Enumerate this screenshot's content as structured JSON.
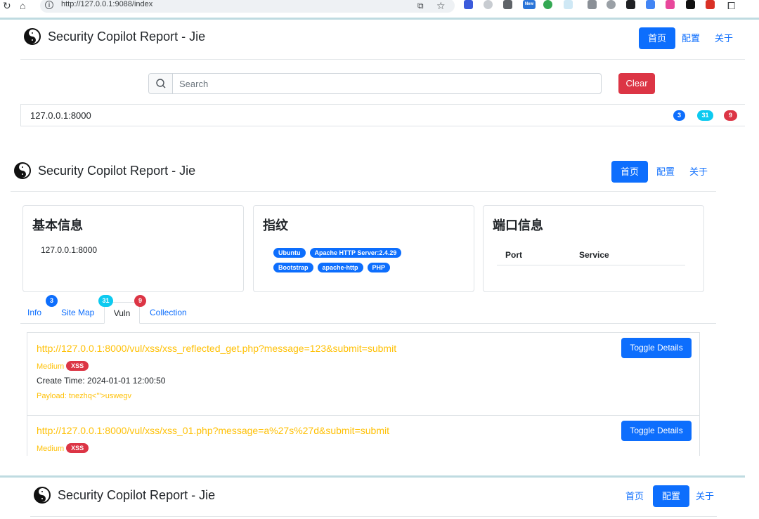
{
  "browser": {
    "url": "http://127.0.0.1:9088/index",
    "extension_new_badge": "New",
    "nav_icons": [
      "reload-icon",
      "home-icon"
    ]
  },
  "app": {
    "title": "Security Copilot Report - Jie",
    "nav": {
      "home": "首页",
      "config": "配置",
      "about": "关于"
    }
  },
  "search": {
    "placeholder": "Search",
    "clear_label": "Clear"
  },
  "host_row": {
    "host": "127.0.0.1:8000",
    "counts": {
      "info": "3",
      "sitemap": "31",
      "vuln": "9"
    }
  },
  "cards": {
    "basic": {
      "title": "基本信息",
      "value": "127.0.0.1:8000"
    },
    "fingerprint": {
      "title": "指纹",
      "tags": [
        "Ubuntu",
        "Apache HTTP Server:2.4.29",
        "Bootstrap",
        "apache-http",
        "PHP"
      ]
    },
    "ports": {
      "title": "端口信息",
      "columns": [
        "Port",
        "Service"
      ]
    }
  },
  "tabs": {
    "items": [
      {
        "label": "Info",
        "badge": "3"
      },
      {
        "label": "Site Map",
        "badge": "31"
      },
      {
        "label": "Vuln",
        "badge": "9"
      },
      {
        "label": "Collection",
        "badge": ""
      }
    ],
    "active": "Vuln"
  },
  "vulns": [
    {
      "url": "http://127.0.0.1:8000/vul/xss/xss_reflected_get.php?message=123&submit=submit",
      "severity": "Medium",
      "type": "XSS",
      "create_time": "Create Time: 2024-01-01 12:00:50",
      "payload": "Payload: tnezhq<'\">uswegv",
      "toggle_label": "Toggle Details"
    },
    {
      "url": "http://127.0.0.1:8000/vul/xss/xss_01.php?message=a%27s%27d&submit=submit",
      "severity": "Medium",
      "type": "XSS",
      "toggle_label": "Toggle Details"
    }
  ],
  "colors": {
    "primary": "#0d6efd",
    "danger": "#dc3545",
    "info": "#0dcaf0",
    "warning": "#ffc107"
  }
}
